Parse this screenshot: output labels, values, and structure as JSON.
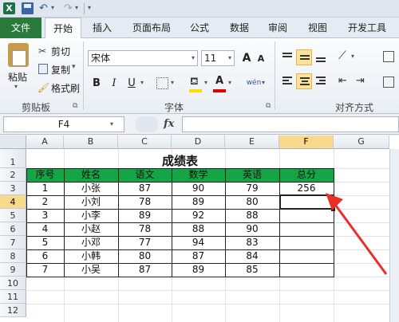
{
  "app": {
    "logo_letter": "X"
  },
  "tabs": {
    "file": "文件",
    "home": "开始",
    "insert": "插入",
    "page_layout": "页面布局",
    "formulas": "公式",
    "data": "数据",
    "review": "审阅",
    "view": "视图",
    "developer": "开发工具"
  },
  "ribbon": {
    "clipboard": {
      "paste": "粘贴",
      "cut": "剪切",
      "copy": "复制",
      "copy_dropdown": "▾",
      "format_painter": "格式刷",
      "label": "剪贴板"
    },
    "font": {
      "font_name": "宋体",
      "font_size": "11",
      "grow": "A",
      "shrink": "A",
      "bold": "B",
      "italic": "I",
      "underline": "U",
      "font_color_letter": "A",
      "phonetic": "wén",
      "label": "字体"
    },
    "alignment": {
      "label": "对齐方式"
    }
  },
  "formula_bar": {
    "name_box": "F4",
    "fx": "fx",
    "formula": ""
  },
  "grid": {
    "columns": [
      "A",
      "B",
      "C",
      "D",
      "E",
      "F",
      "G"
    ],
    "rows": [
      "1",
      "2",
      "3",
      "4",
      "5",
      "6",
      "7",
      "8",
      "9",
      "10",
      "11",
      "12"
    ],
    "selected_column": "F",
    "selected_row": "4"
  },
  "sheet": {
    "title": "成绩表",
    "headers": [
      "序号",
      "姓名",
      "语文",
      "数学",
      "英语",
      "总分"
    ],
    "rows": [
      [
        "1",
        "小张",
        "87",
        "90",
        "79",
        "256"
      ],
      [
        "2",
        "小刘",
        "78",
        "89",
        "80",
        ""
      ],
      [
        "3",
        "小李",
        "89",
        "92",
        "88",
        ""
      ],
      [
        "4",
        "小赵",
        "78",
        "88",
        "90",
        ""
      ],
      [
        "5",
        "小邓",
        "77",
        "94",
        "83",
        ""
      ],
      [
        "6",
        "小韩",
        "80",
        "87",
        "84",
        ""
      ],
      [
        "7",
        "小吴",
        "87",
        "89",
        "85",
        ""
      ]
    ]
  },
  "colors": {
    "header_fill": "#16a546",
    "annotation_arrow": "#e8302a",
    "file_tab": "#2a7a3d"
  }
}
